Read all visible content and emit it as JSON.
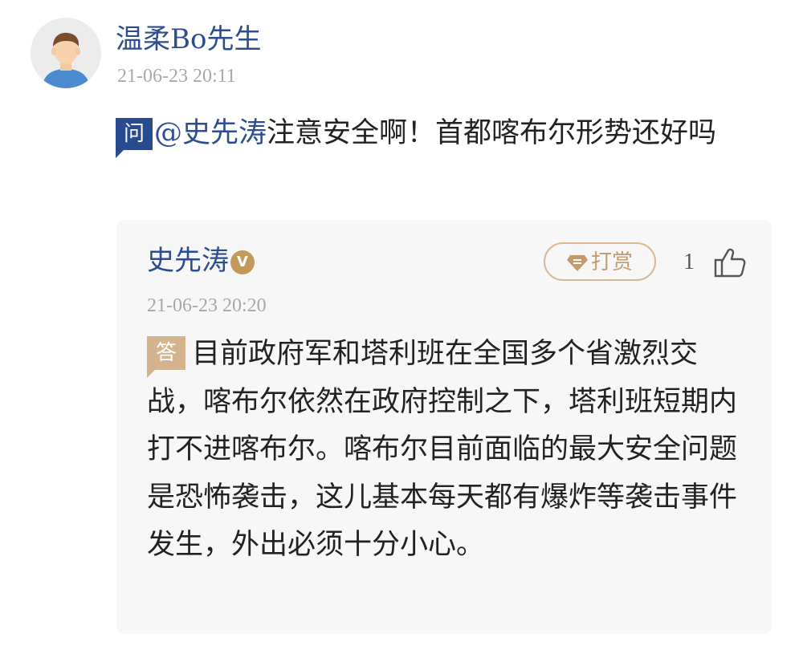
{
  "question": {
    "asker_name": "温柔Bo先生",
    "timestamp": "21-06-23 20:11",
    "badge": "问",
    "mention": "@史先涛",
    "text": "注意安全啊！首都喀布尔形势还好吗"
  },
  "answer": {
    "answerer_name": "史先涛",
    "verified_mark": "V",
    "tip_label": "打赏",
    "like_count": "1",
    "timestamp": "21-06-23 20:20",
    "badge": "答",
    "text": "目前政府军和塔利班在全国多个省激烈交战，喀布尔依然在政府控制之下，塔利班短期内打不进喀布尔。喀布尔目前面临的最大安全问题是恐怖袭击，这儿基本每天都有爆炸等袭击事件发生，外出必须十分小心。"
  },
  "colors": {
    "name_blue": "#2e4d8f",
    "question_badge": "#284b8f",
    "answer_badge": "#d3b48c",
    "tip_gold": "#c69a6d",
    "card_bg": "#f7f7f7",
    "timestamp_gray": "#a8a8a8"
  },
  "icons": {
    "avatar": "default-user-avatar",
    "verified": "verified-v-badge",
    "tip": "reward-gem-icon",
    "like": "thumbs-up-icon"
  }
}
